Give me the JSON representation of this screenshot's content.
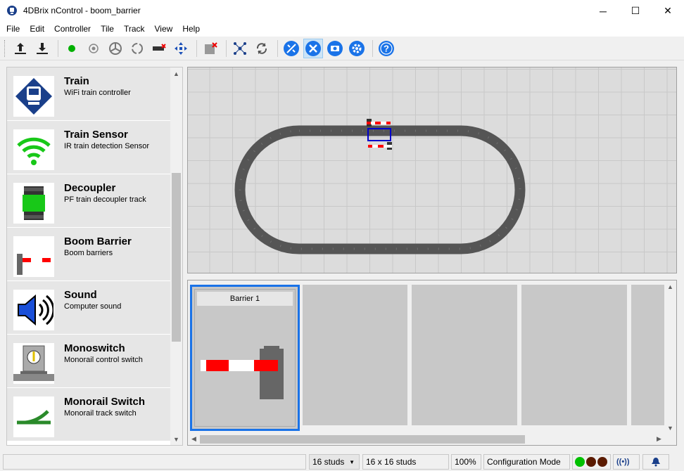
{
  "window": {
    "title": "4DBrix nControl - boom_barrier",
    "minimize": "─",
    "maximize": "☐",
    "close": "✕"
  },
  "menu": [
    "File",
    "Edit",
    "Controller",
    "Tile",
    "Track",
    "View",
    "Help"
  ],
  "toolbar": {
    "icons": [
      "upload-icon",
      "download-icon",
      "green-dot-icon",
      "sensor-icon",
      "triple-arrows-icon",
      "circle-arrows-icon",
      "decoupler-icon",
      "cross-arrows-icon",
      "delete-icon",
      "network-icon",
      "refresh-icon",
      "no-connection-icon",
      "tools-icon",
      "camera-icon",
      "settings-icon",
      "help-icon"
    ]
  },
  "palette": {
    "items": [
      {
        "name": "Train",
        "desc": "WiFi train controller",
        "icon": "train-icon"
      },
      {
        "name": "Train Sensor",
        "desc": "IR train detection Sensor",
        "icon": "wifi-sensor-icon"
      },
      {
        "name": "Decoupler",
        "desc": "PF train decoupler track",
        "icon": "decoupler-icon"
      },
      {
        "name": "Boom Barrier",
        "desc": "Boom barriers",
        "icon": "boom-barrier-icon"
      },
      {
        "name": "Sound",
        "desc": "Computer sound",
        "icon": "speaker-icon"
      },
      {
        "name": "Monoswitch",
        "desc": "Monorail control switch",
        "icon": "monoswitch-icon"
      },
      {
        "name": "Monorail Switch",
        "desc": "Monorail track switch",
        "icon": "monorail-switch-icon"
      }
    ]
  },
  "tiles": [
    {
      "title": "Barrier 1",
      "selected": true
    }
  ],
  "status": {
    "grid": "16 studs",
    "size": "16 x 16 studs",
    "zoom": "100%",
    "mode": "Configuration Mode",
    "lights": [
      "#00c000",
      "#5a1a00",
      "#5a1a00"
    ],
    "signal": "((•))"
  },
  "colors": {
    "accent": "#1a73e8",
    "barrier_red": "#ff0000",
    "track": "#555555"
  }
}
